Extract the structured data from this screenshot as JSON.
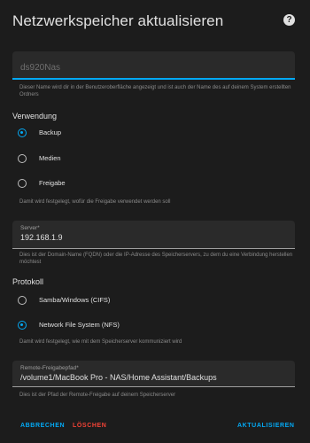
{
  "dialog": {
    "title": "Netzwerkspeicher aktualisieren",
    "help_icon": "help-circle-icon"
  },
  "name_field": {
    "placeholder": "ds920Nas",
    "helper": "Dieser Name wird dir in der Benutzeroberfläche angezeigt und ist auch der Name des auf deinem System erstellten Ordners"
  },
  "usage": {
    "label": "Verwendung",
    "options": [
      {
        "label": "Backup",
        "checked": true
      },
      {
        "label": "Medien",
        "checked": false
      },
      {
        "label": "Freigabe",
        "checked": false
      }
    ],
    "helper": "Damit wird festgelegt, wofür die Freigabe verwendet werden soll"
  },
  "server_field": {
    "label": "Server*",
    "value": "192.168.1.9",
    "helper": "Dies ist der Domain-Name (FQDN) oder die IP-Adresse des Speicherservers, zu dem du eine Verbindung herstellen möchtest"
  },
  "protocol": {
    "label": "Protokoll",
    "options": [
      {
        "label": "Samba/Windows (CIFS)",
        "checked": false
      },
      {
        "label": "Network File System (NFS)",
        "checked": true
      }
    ],
    "helper": "Damit wird festgelegt, wie mit dem Speicherserver kommuniziert wird"
  },
  "path_field": {
    "label": "Remote-Freigabepfad*",
    "value": "/volume1/MacBook Pro - NAS/Home Assistant/Backups",
    "helper": "Dies ist der Pfad der Remote-Freigabe auf deinem Speicherserver"
  },
  "buttons": {
    "cancel": "ABBRECHEN",
    "delete": "LÖSCHEN",
    "update": "AKTUALISIEREN"
  },
  "colors": {
    "accent": "#03a9f4",
    "danger": "#f44336",
    "background": "#1c1c1c",
    "field_background": "#2a2a2a"
  }
}
